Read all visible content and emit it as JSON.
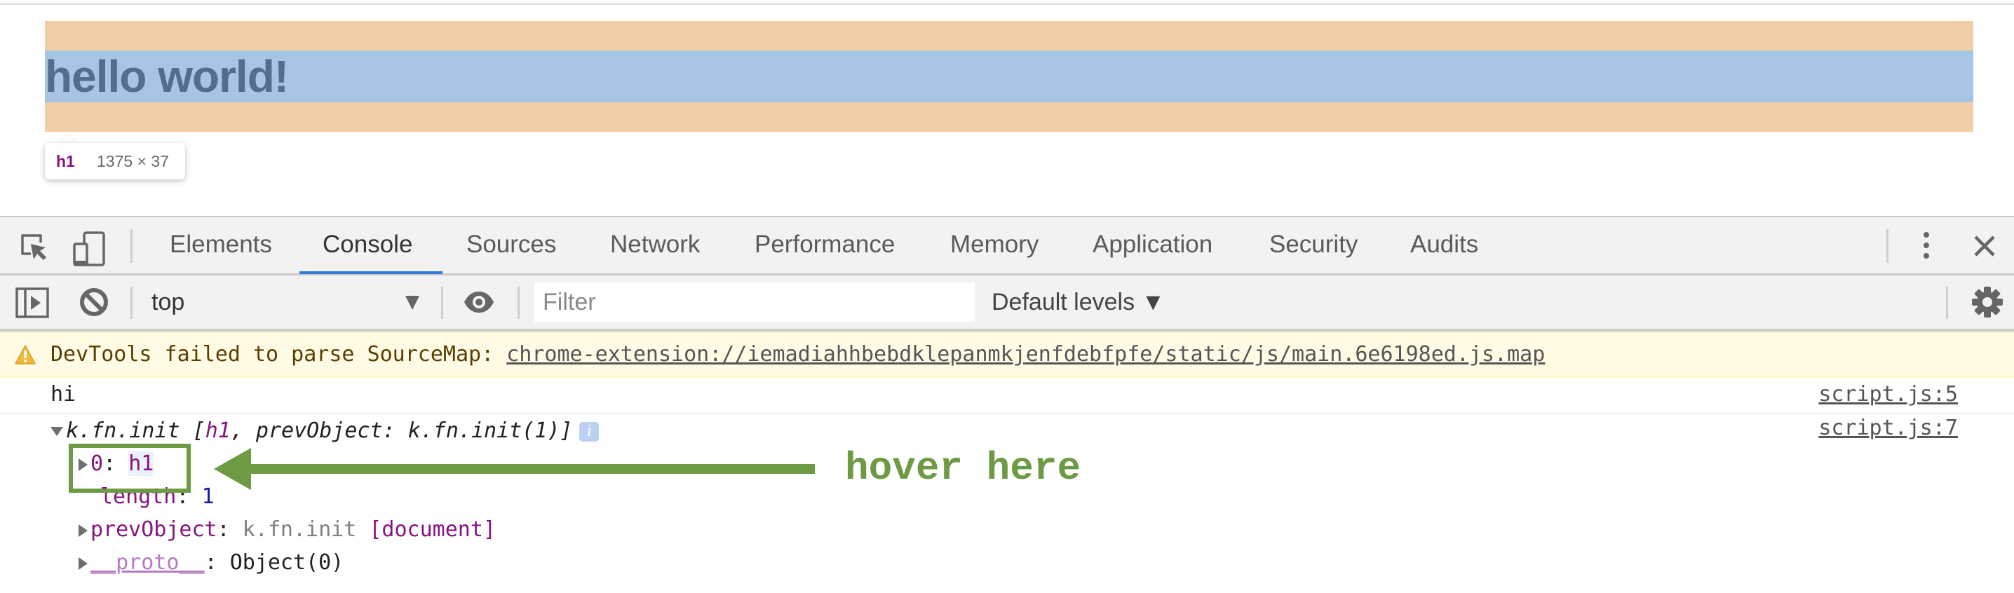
{
  "page": {
    "heading": "hello world!",
    "inspect_tooltip": {
      "tag": "h1",
      "dimensions": "1375 × 37"
    },
    "highlight_colors": {
      "margin": "#f3cda6",
      "content": "#a6c4e3"
    }
  },
  "devtools": {
    "tabs": [
      {
        "label": "Elements",
        "active": false
      },
      {
        "label": "Console",
        "active": true
      },
      {
        "label": "Sources",
        "active": false
      },
      {
        "label": "Network",
        "active": false
      },
      {
        "label": "Performance",
        "active": false
      },
      {
        "label": "Memory",
        "active": false
      },
      {
        "label": "Application",
        "active": false
      },
      {
        "label": "Security",
        "active": false
      },
      {
        "label": "Audits",
        "active": false
      }
    ],
    "toolbar": {
      "context": "top",
      "filter_placeholder": "Filter",
      "filter_value": "",
      "levels": "Default levels ▼"
    },
    "icons": {
      "inspect": "inspect-element-icon",
      "device": "device-toolbar-icon",
      "more": "more-vertical-icon",
      "close": "close-icon",
      "sidebar": "show-sidebar-icon",
      "clear": "clear-console-icon",
      "eye": "live-expression-icon",
      "settings": "gear-icon",
      "warning": "warning-icon",
      "info": "info-icon"
    },
    "accent_color": "#3879d9"
  },
  "console": {
    "warning": {
      "prefix": "DevTools failed to parse SourceMap: ",
      "link": "chrome-extension://iemadiahhbebdklepanmkjenfdebfpfe/static/js/main.6e6198ed.js.map"
    },
    "messages": [
      {
        "text": "hi",
        "source": "script.js:5"
      },
      {
        "source": "script.js:7",
        "summary": {
          "name": "k.fn.init",
          "open": " [",
          "elem": "h1",
          "rest": ", prevObject: k.fn.init(1)]"
        },
        "children": [
          {
            "key": "0",
            "sep": ": ",
            "value": "h1"
          },
          {
            "key": "length",
            "sep": ": ",
            "value": "1"
          },
          {
            "key": "prevObject",
            "sep": ": ",
            "value_prefix": "k.fn.init ",
            "value": "[document]"
          },
          {
            "key": "__proto__",
            "sep": ": ",
            "value": "Object(0)"
          }
        ]
      }
    ]
  },
  "annotation": {
    "label": "hover here",
    "color": "#6e9a44"
  }
}
